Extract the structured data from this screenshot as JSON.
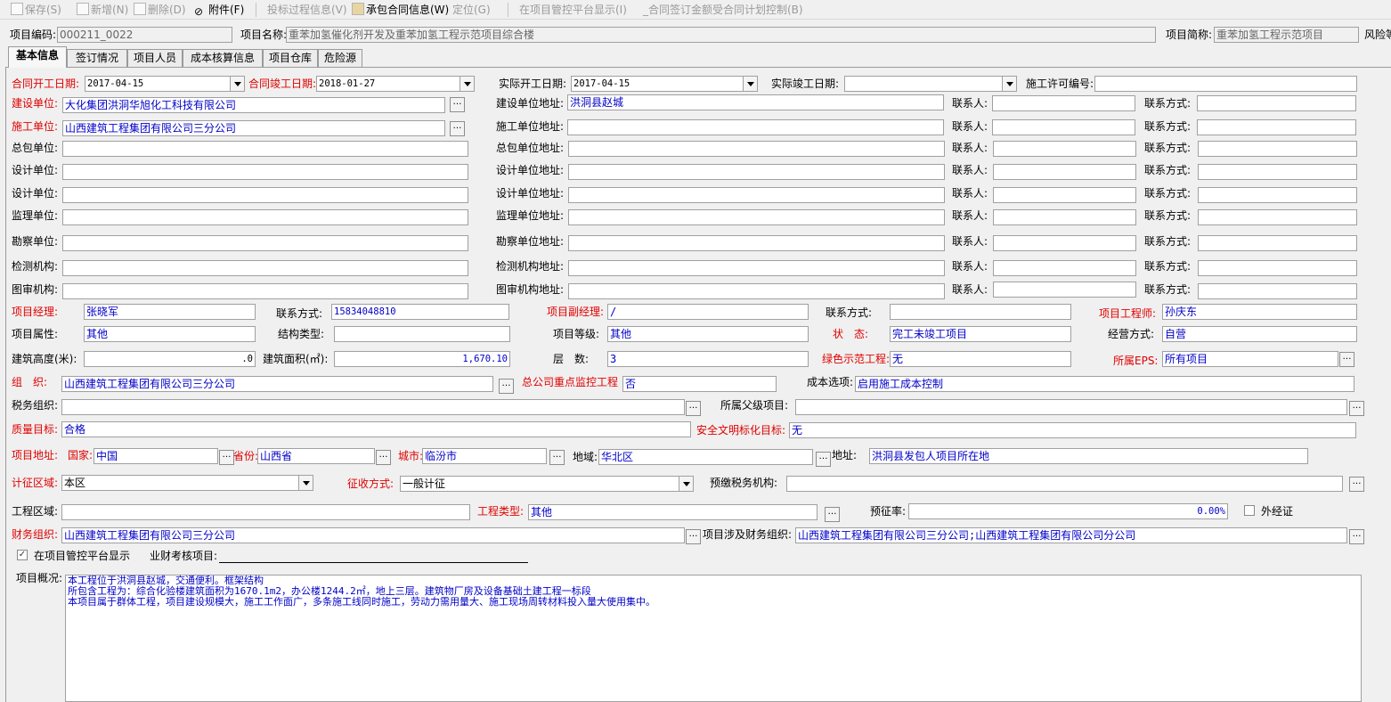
{
  "toolbar": {
    "save": "保存(S)",
    "add": "新增(N)",
    "delete": "删除(D)",
    "attach": "附件(F)",
    "bid": "投标过程信息(V)",
    "contract": "承包合同信息(W)",
    "locate": "定位(G)",
    "show": "在项目管控平台显示(I)",
    "control": "_合同签订金额受合同计划控制(B)"
  },
  "header": {
    "code_label": "项目编码:",
    "code": "000211_0022",
    "name_label": "项目名称:",
    "name": "重苯加氢催化剂开发及重苯加氢工程示范项目综合楼",
    "short_label": "项目简称:",
    "short": "重苯加氢工程示范项目",
    "risk_label": "风险等"
  },
  "tabs": [
    "基本信息",
    "签订情况",
    "项目人员",
    "成本核算信息",
    "项目仓库",
    "危险源"
  ],
  "dates": {
    "contract_start_label": "合同开工日期:",
    "contract_start": "2017-04-15",
    "contract_end_label": "合同竣工日期:",
    "contract_end": "2018-01-27",
    "actual_start_label": "实际开工日期:",
    "actual_start": "2017-04-15",
    "actual_end_label": "实际竣工日期:",
    "actual_end": "",
    "permit_label": "施工许可编号:",
    "permit": ""
  },
  "units": [
    {
      "label": "建设单位:",
      "value": "大化集团洪洞华旭化工科技有限公司",
      "addr_label": "建设单位地址:",
      "addr": "洪洞县赵城"
    },
    {
      "label": "施工单位:",
      "value": "山西建筑工程集团有限公司三分公司",
      "addr_label": "施工单位地址:",
      "addr": ""
    },
    {
      "label": "总包单位:",
      "value": "",
      "addr_label": "总包单位地址:",
      "addr": ""
    },
    {
      "label": "设计单位:",
      "value": "",
      "addr_label": "设计单位地址:",
      "addr": ""
    },
    {
      "label": "设计单位:",
      "value": "",
      "addr_label": "设计单位地址:",
      "addr": ""
    },
    {
      "label": "监理单位:",
      "value": "",
      "addr_label": "监理单位地址:",
      "addr": ""
    },
    {
      "label": "勘察单位:",
      "value": "",
      "addr_label": "勘察单位地址:",
      "addr": ""
    },
    {
      "label": "检测机构:",
      "value": "",
      "addr_label": "检测机构地址:",
      "addr": ""
    },
    {
      "label": "图审机构:",
      "value": "",
      "addr_label": "图审机构地址:",
      "addr": ""
    }
  ],
  "contact_label": "联系人:",
  "contact_way_label": "联系方式:",
  "people": {
    "manager_label": "项目经理:",
    "manager": "张晓军",
    "phone_label": "联系方式:",
    "phone": "15834048810",
    "deputy_label": "项目副经理:",
    "deputy": "/",
    "deputy_phone_label": "联系方式:",
    "deputy_phone": "",
    "engineer_label": "项目工程师:",
    "engineer": "孙庆东"
  },
  "attrs": {
    "attr_label": "项目属性:",
    "attr": "其他",
    "struct_label": "结构类型:",
    "struct": "",
    "grade_label": "项目等级:",
    "grade": "其他",
    "status_label": "状　态:",
    "status": "完工未竣工项目",
    "mode_label": "经营方式:",
    "mode": "自营"
  },
  "metrics": {
    "height_label": "建筑高度(米):",
    "height": ".0",
    "area_label": "建筑面积(㎡):",
    "area": "1,670.10",
    "floors_label": "层　数:",
    "floors": "3",
    "green_label": "绿色示范工程:",
    "green": "无",
    "eps_label": "所属EPS:",
    "eps": "所有项目"
  },
  "org": {
    "org_label": "组　织:",
    "org": "山西建筑工程集团有限公司三分公司",
    "key_label": "总公司重点监控工程",
    "key": "否",
    "cost_label": "成本选项:",
    "cost": "启用施工成本控制",
    "tax_label": "税务组织:",
    "tax": "",
    "parent_label": "所属父级项目:",
    "parent": "",
    "quality_label": "质量目标:",
    "quality": "合格",
    "safety_label": "安全文明标化目标:",
    "safety": "无"
  },
  "address": {
    "label": "项目地址:",
    "country_label": "国家:",
    "country": "中国",
    "province_label": "省份:",
    "province": "山西省",
    "city_label": "城市:",
    "city": "临汾市",
    "region_label": "地域:",
    "region": "华北区",
    "addr_label": "地址:",
    "addr": "洪洞县发包人项目所在地"
  },
  "tax": {
    "area_label": "计征区域:",
    "area": "本区",
    "method_label": "征收方式:",
    "method": "一般计征",
    "agency_label": "预缴税务机构:",
    "agency": "",
    "zone_label": "工程区域:",
    "zone": "",
    "type_label": "工程类型:",
    "type": "其他",
    "rate_label": "预征率:",
    "rate": "0.00%",
    "external_label": "外经证"
  },
  "finance": {
    "label": "财务组织:",
    "value": "山西建筑工程集团有限公司三分公司",
    "involved_label": "项目涉及财务组织:",
    "involved": "山西建筑工程集团有限公司三分公司;山西建筑工程集团有限公司分公司"
  },
  "platform": {
    "show_label": "在项目管控平台显示",
    "audit_label": "业财考核项目:"
  },
  "overview": {
    "label": "项目概况:",
    "lines": [
      "本工程位于洪洞县赵城，交通便利。框架结构",
      "所包含工程为：综合化验楼建筑面积为1670.1m2，办公楼1244.2㎡，地上三层。建筑物厂房及设备基础土建工程一标段",
      "本项目属于群体工程，项目建设规模大，施工工作面广，多条施工线同时施工，劳动力需用量大、施工现场周转材料投入量大使用集中。"
    ]
  },
  "colors": {
    "required_label": "#e00000",
    "value_text": "#0000c8"
  }
}
